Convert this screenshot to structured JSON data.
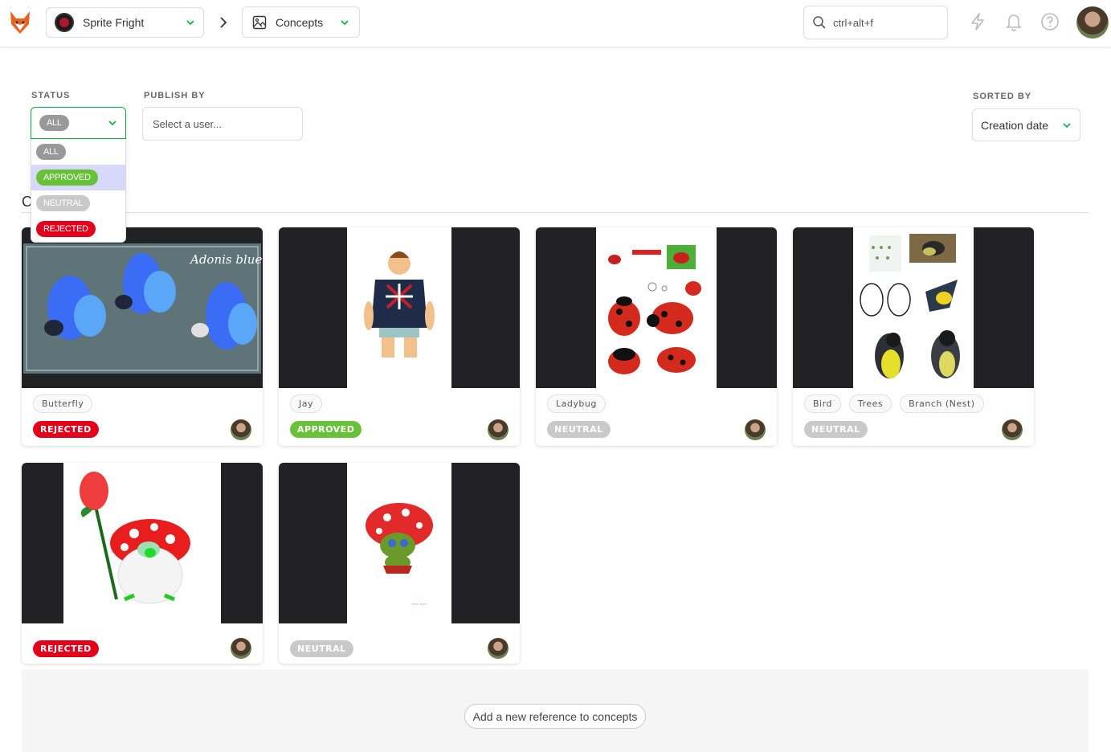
{
  "topbar": {
    "project": "Sprite Fright",
    "section": "Concepts",
    "search_placeholder": "ctrl+alt+f"
  },
  "filters": {
    "status_label": "STATUS",
    "status_value": "ALL",
    "status_options": [
      "ALL",
      "APPROVED",
      "NEUTRAL",
      "REJECTED"
    ],
    "publish_label": "PUBLISH BY",
    "publish_placeholder": "Select a user...",
    "sort_label": "SORTED BY",
    "sort_value": "Creation date"
  },
  "section_title": "C",
  "cards": [
    {
      "tags": [
        "Butterfly"
      ],
      "status": "REJECTED",
      "status_color": "#e4001b",
      "image": "butterfly-concept"
    },
    {
      "tags": [
        "Jay"
      ],
      "status": "APPROVED",
      "status_color": "#67c23a",
      "image": "character-jay"
    },
    {
      "tags": [
        "Ladybug"
      ],
      "status": "NEUTRAL",
      "status_color": "#c9c9c9",
      "image": "ladybug-sheet"
    },
    {
      "tags": [
        "Bird",
        "Trees",
        "Branch (Nest)"
      ],
      "status": "NEUTRAL",
      "status_color": "#c9c9c9",
      "image": "bird-sheet"
    },
    {
      "tags": [],
      "status": "REJECTED",
      "status_color": "#e4001b",
      "image": "mushroom-rose"
    },
    {
      "tags": [],
      "status": "NEUTRAL",
      "status_color": "#c9c9c9",
      "image": "mushroom-goblin"
    }
  ],
  "add_reference": "Add a new reference to concepts",
  "colors": {
    "accent": "#00b242",
    "rejected": "#e4001b",
    "approved": "#67c23a",
    "neutral": "#c9c9c9",
    "all": "#999999"
  }
}
